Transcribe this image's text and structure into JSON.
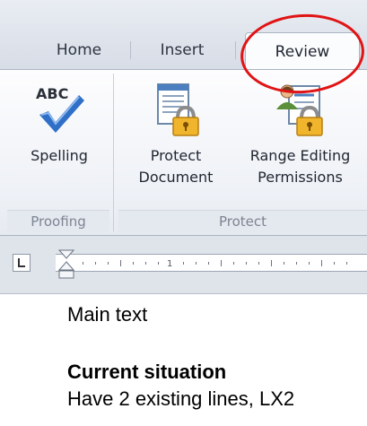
{
  "tabs": [
    {
      "label": "Home",
      "active": false
    },
    {
      "label": "Insert",
      "active": false
    },
    {
      "label": "Review",
      "active": true
    }
  ],
  "ribbon": {
    "groups": [
      {
        "label": "Proofing"
      },
      {
        "label": "Protect"
      }
    ],
    "spelling": {
      "icon_text": "ABC",
      "label": "Spelling"
    },
    "protect_document": {
      "label_line1": "Protect",
      "label_line2": "Document"
    },
    "range_editing": {
      "label_line1": "Range Editing",
      "label_line2": "Permissions"
    }
  },
  "ruler": {
    "marker": "1"
  },
  "document": {
    "lines": [
      {
        "text": "Main text",
        "style": "normal"
      },
      {
        "text": "Current situation",
        "style": "bold"
      },
      {
        "text": "Have 2 existing lines, LX2",
        "style": "normal"
      }
    ]
  },
  "colors": {
    "annotation": "#e01414",
    "ribbon_background": "#eef1f6",
    "tab_strip": "#dde2ea",
    "group_label": "#7d8592"
  }
}
